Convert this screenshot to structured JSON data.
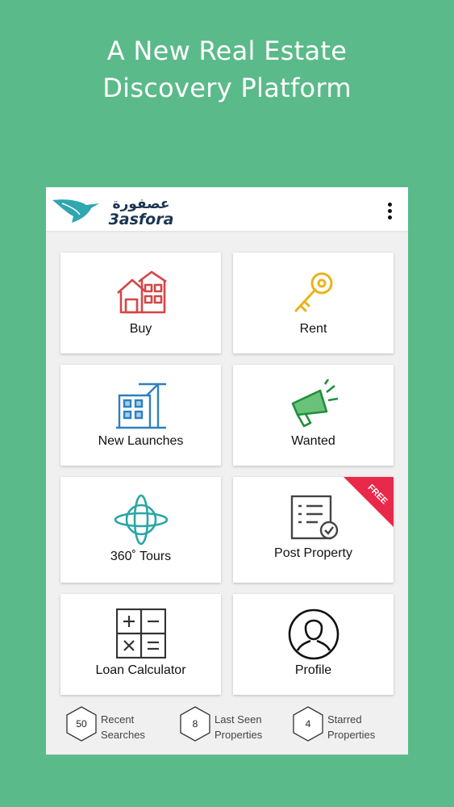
{
  "promo": {
    "line1": "A New Real Estate",
    "line2": "Discovery Platform"
  },
  "app": {
    "logo_text_arabic": "عصفورة",
    "logo_text_latin": "3asfora",
    "brand_color": "#2fa6b0"
  },
  "tiles": [
    {
      "label": "Buy",
      "icon": "house-icon",
      "color": "#d64545"
    },
    {
      "label": "Rent",
      "icon": "key-icon",
      "color": "#e8b41c"
    },
    {
      "label": "New Launches",
      "icon": "building-crane-icon",
      "color": "#2f7fc1"
    },
    {
      "label": "Wanted",
      "icon": "megaphone-icon",
      "color": "#1f8f3c"
    },
    {
      "label": "360˚ Tours",
      "icon": "globe-360-icon",
      "color": "#2aa6a6"
    },
    {
      "label": "Post Property",
      "icon": "document-check-icon",
      "color": "#444444",
      "badge": "FREE"
    },
    {
      "label": "Loan Calculator",
      "icon": "calculator-icon",
      "color": "#333333"
    },
    {
      "label": "Profile",
      "icon": "user-circle-icon",
      "color": "#111111"
    }
  ],
  "stats": [
    {
      "count": "50",
      "line1": "Recent",
      "line2": "Searches"
    },
    {
      "count": "8",
      "line1": "Last Seen",
      "line2": "Properties"
    },
    {
      "count": "4",
      "line1": "Starred",
      "line2": "Properties"
    }
  ],
  "colors": {
    "background": "#5bba8a",
    "ribbon": "#e8294a"
  }
}
